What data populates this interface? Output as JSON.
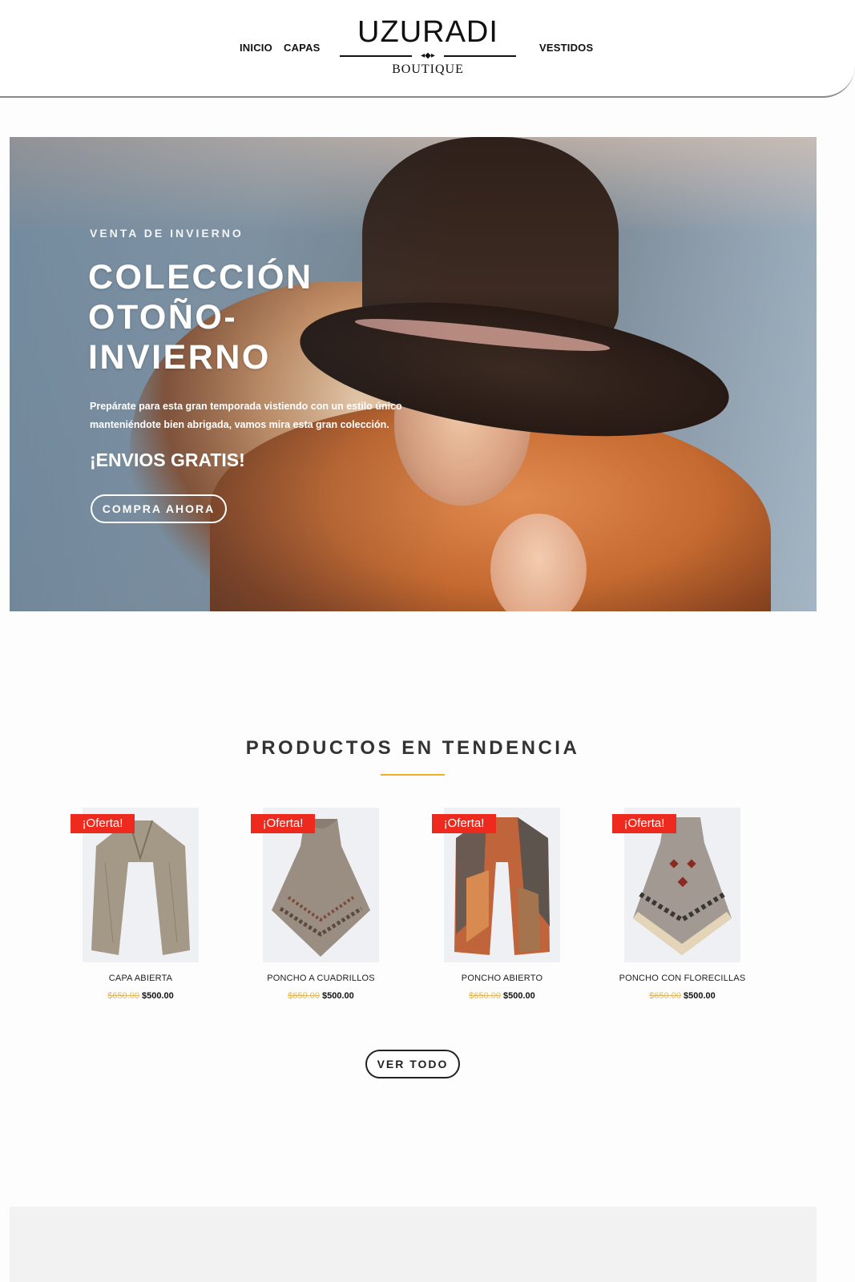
{
  "nav": {
    "items": [
      "INICIO",
      "CAPAS",
      "VESTIDOS"
    ]
  },
  "logo": {
    "main": "UZURADI",
    "sub": "BOUTIQUE"
  },
  "hero": {
    "kicker": "VENTA DE INVIERNO",
    "title": "COLECCIÓN OTOÑO-INVIERNO",
    "description": "Prepárate para esta gran temporada vistiendo con un estilo único manteniéndote bien abrigada, vamos mira esta gran colección.",
    "promo": "¡ENVIOS GRATIS!",
    "cta": "COMPRA AHORA"
  },
  "trending": {
    "title": "PRODUCTOS EN TENDENCIA",
    "accent_color": "#f0b020",
    "products": [
      {
        "badge": "¡Oferta!",
        "name": "CAPA ABIERTA",
        "old_price": "$650.00",
        "price": "$500.00"
      },
      {
        "badge": "¡Oferta!",
        "name": "PONCHO A CUADRILLOS",
        "old_price": "$650.00",
        "price": "$500.00"
      },
      {
        "badge": "¡Oferta!",
        "name": "PONCHO ABIERTO",
        "old_price": "$650.00",
        "price": "$500.00"
      },
      {
        "badge": "¡Oferta!",
        "name": "PONCHO CON FLORECILLAS",
        "old_price": "$650.00",
        "price": "$500.00"
      }
    ],
    "view_all": "VER TODO"
  },
  "colors": {
    "badge": "#ee2a1f",
    "old_price": "#e4b85a"
  }
}
